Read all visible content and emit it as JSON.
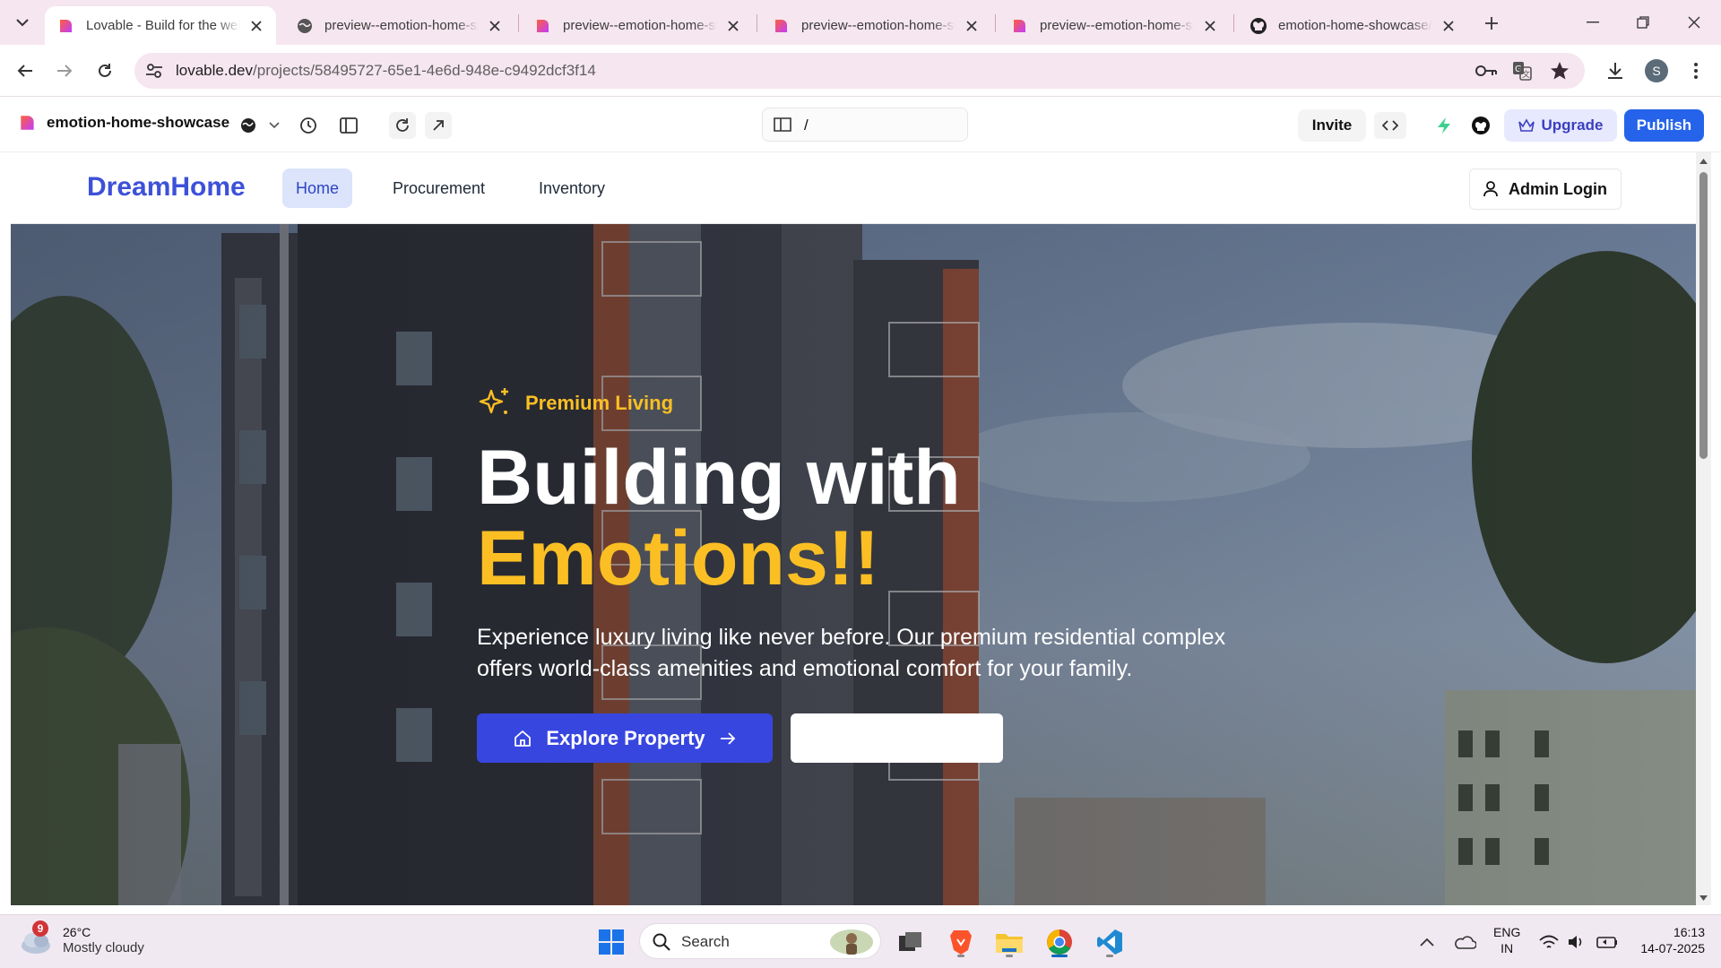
{
  "browser": {
    "tabs": [
      {
        "title": "Lovable - Build for the web",
        "active": true,
        "favicon": "lovable-heart-icon"
      },
      {
        "title": "preview--emotion-home-showcase",
        "active": false,
        "favicon": "globe-icon"
      },
      {
        "title": "preview--emotion-home-showcase",
        "active": false,
        "favicon": "lovable-heart-icon"
      },
      {
        "title": "preview--emotion-home-showcase",
        "active": false,
        "favicon": "lovable-heart-icon"
      },
      {
        "title": "preview--emotion-home-showcase",
        "active": false,
        "favicon": "lovable-heart-icon"
      },
      {
        "title": "emotion-home-showcase/",
        "active": false,
        "favicon": "github-icon"
      }
    ],
    "url_host": "lovable.dev",
    "url_path": "/projects/58495727-65e1-4e6d-948e-c9492dcf3f14",
    "profile_initial": "S"
  },
  "lovable": {
    "project_name": "emotion-home-showcase",
    "route": "/",
    "invite_label": "Invite",
    "upgrade_label": "Upgrade",
    "publish_label": "Publish"
  },
  "site": {
    "brand": "DreamHome",
    "nav": [
      {
        "label": "Home",
        "active": true
      },
      {
        "label": "Procurement",
        "active": false
      },
      {
        "label": "Inventory",
        "active": false
      }
    ],
    "admin_login": "Admin Login",
    "hero": {
      "tagline": "Premium Living",
      "heading_line1": "Building with",
      "heading_line2": "Emotions!!",
      "description": "Experience luxury living like never before. Our premium residential complex offers world-class amenities and emotional comfort for your family.",
      "cta_primary": "Explore Property",
      "cta_secondary": ""
    }
  },
  "taskbar": {
    "weather_badge": "9",
    "temperature": "26°C",
    "condition": "Mostly cloudy",
    "search_label": "Search",
    "lang_line1": "ENG",
    "lang_line2": "IN",
    "time": "16:13",
    "date": "14-07-2025"
  },
  "colors": {
    "brand_blue": "#3d51d8",
    "accent_yellow": "#fbbf24",
    "publish_blue": "#2563eb",
    "cta_blue": "#3846e0"
  }
}
